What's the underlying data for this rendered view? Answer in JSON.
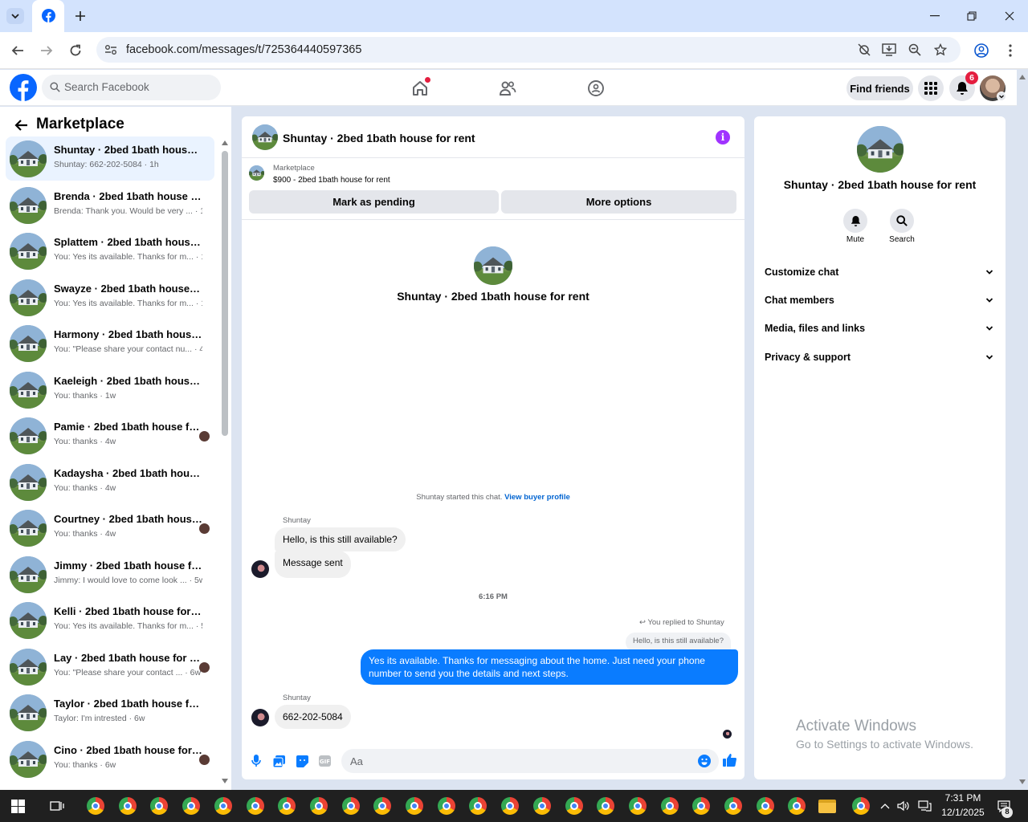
{
  "browser": {
    "url": "facebook.com/messages/t/725364440597365"
  },
  "fb": {
    "search_placeholder": "Search Facebook",
    "find_friends": "Find friends",
    "notif_count": "6"
  },
  "sidebar": {
    "title": "Marketplace",
    "conversations": [
      {
        "name": "Shuntay · 2bed 1bath house for ...",
        "preview": "Shuntay: 662-202-5084 · 1h",
        "selected": true
      },
      {
        "name": "Brenda · 2bed 1bath house for r...",
        "preview": "Brenda: Thank you. Would be very ... · 1h"
      },
      {
        "name": "Splattem · 2bed 1bath house for...",
        "preview": "You: Yes its available. Thanks for m... · 1h"
      },
      {
        "name": "Swayze · 2bed 1bath house for r...",
        "preview": "You: Yes its available. Thanks for m... · 1d"
      },
      {
        "name": "Harmony · 2bed 1bath house fo...",
        "preview": "You: \"Please share your contact nu... · 4d"
      },
      {
        "name": "Kaeleigh · 2bed 1bath house for...",
        "preview": "You: thanks · 1w"
      },
      {
        "name": "Pamie · 2bed 1bath house for...",
        "preview": "You: thanks · 4w",
        "avatar": true
      },
      {
        "name": "Kadaysha · 2bed 1bath house fo...",
        "preview": "You: thanks · 4w"
      },
      {
        "name": "Courtney · 2bed 1bath house ...",
        "preview": "You: thanks · 4w",
        "avatar": true
      },
      {
        "name": "Jimmy · 2bed 1bath house for r...",
        "preview": "Jimmy: I would love to come look ... · 5w"
      },
      {
        "name": "Kelli · 2bed 1bath house for rent",
        "preview": "You: Yes its available. Thanks for m... · 5w"
      },
      {
        "name": "Lay · 2bed 1bath house for rent",
        "preview": "You: \"Please share your contact ... · 6w",
        "avatar": true
      },
      {
        "name": "Taylor · 2bed 1bath house for rent",
        "preview": "Taylor: I'm intrested · 6w"
      },
      {
        "name": "Cino · 2bed 1bath house for r...",
        "preview": "You: thanks · 6w",
        "avatar": true
      }
    ]
  },
  "chat": {
    "title": "Shuntay · 2bed 1bath house for rent",
    "listing_label": "Marketplace",
    "listing_detail": "$900 - 2bed 1bath house for rent",
    "mark_pending": "Mark as pending",
    "more_options": "More options",
    "profile_name": "Shuntay · 2bed 1bath house for rent",
    "started_text": "Shuntay started this chat.",
    "view_buyer_profile": "View buyer profile",
    "sender1": "Shuntay",
    "msg1": "Hello, is this still available?",
    "msg2": "Message sent",
    "time": "6:16 PM",
    "replied_to": "You replied to Shuntay",
    "quoted": "Hello, is this still available?",
    "my_reply_line1": "Yes its available. Thanks for messaging about the home. Just need your phone",
    "my_reply_line2": "number to send you the details and next steps.",
    "sender2": "Shuntay",
    "msg3": "662-202-5084",
    "composer_placeholder": "Aa"
  },
  "details": {
    "name": "Shuntay · 2bed 1bath house for rent",
    "mute": "Mute",
    "search": "Search",
    "sections": [
      "Customize chat",
      "Chat members",
      "Media, files and links",
      "Privacy & support"
    ]
  },
  "watermark": {
    "line1": "Activate Windows",
    "line2": "Go to Settings to activate Windows."
  },
  "taskbar": {
    "time": "7:31 PM",
    "date": "12/1/2025",
    "notif": "8"
  }
}
